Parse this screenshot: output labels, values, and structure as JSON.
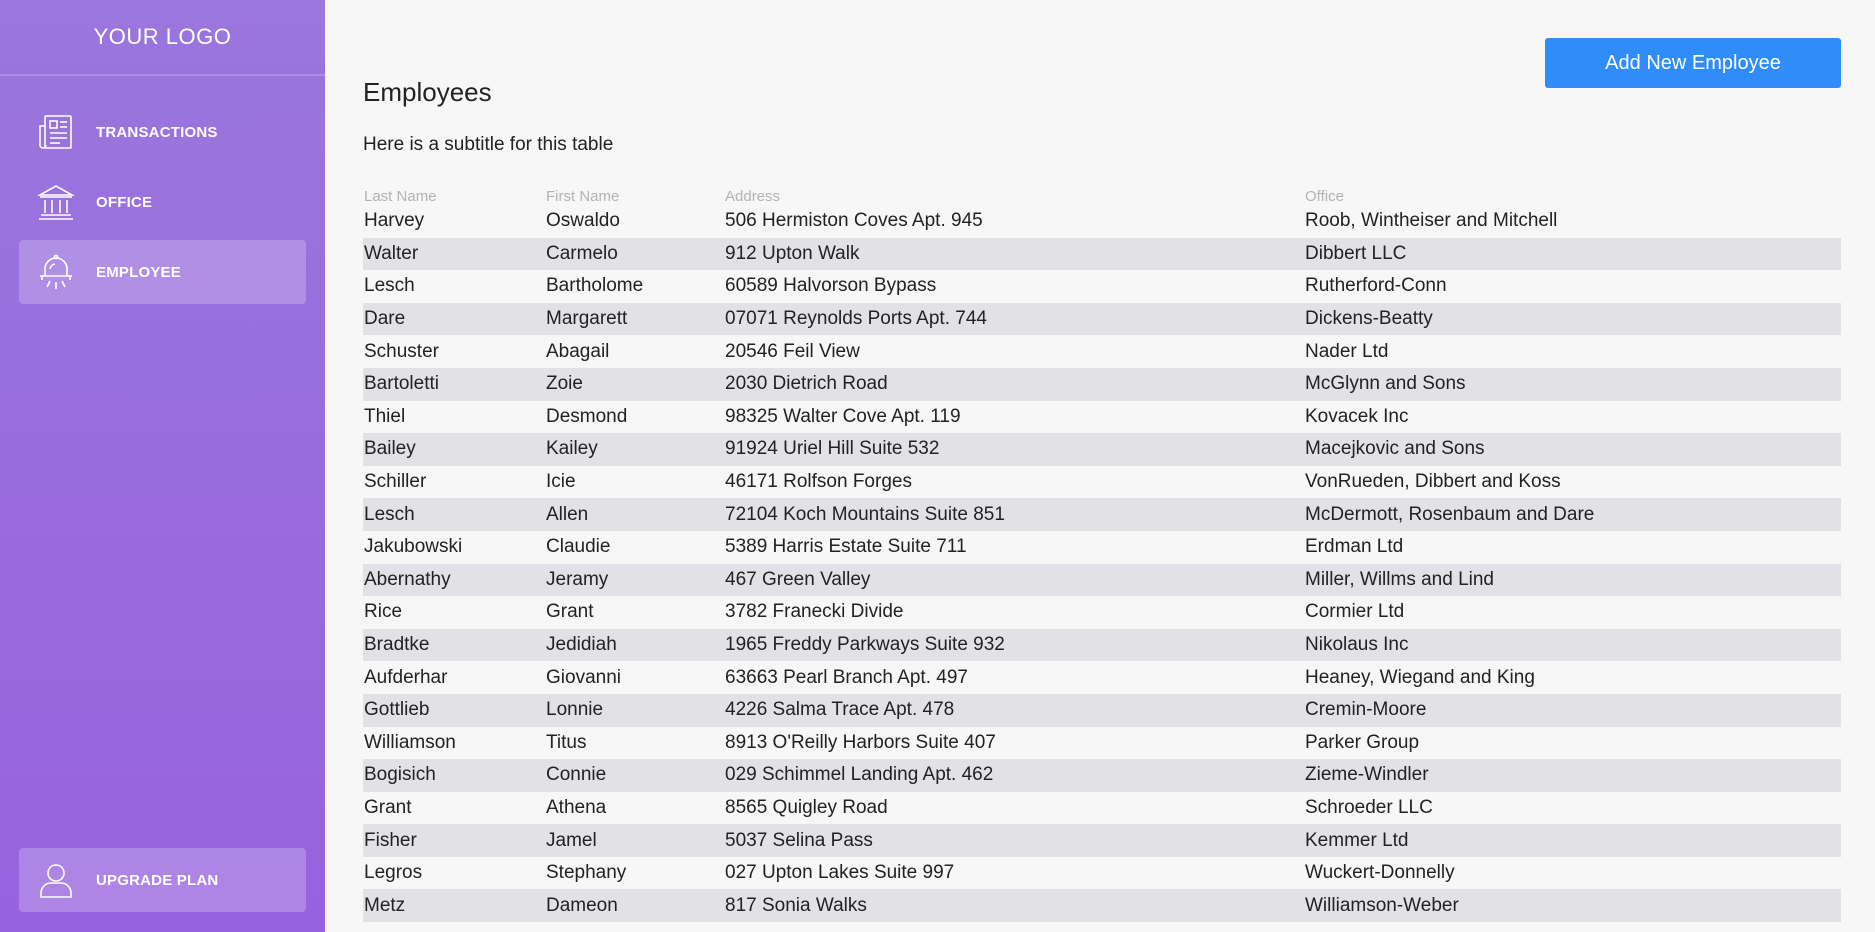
{
  "logo": "YOUR LOGO",
  "nav": {
    "transactions": "TRANSACTIONS",
    "office": "OFFICE",
    "employee": "EMPLOYEE",
    "upgrade": "UPGRADE PLAN"
  },
  "header": {
    "add_button": "Add New Employee",
    "title": "Employees",
    "subtitle": "Here is a subtitle for this table"
  },
  "table": {
    "columns": [
      "Last Name",
      "First Name",
      "Address",
      "Office"
    ],
    "rows": [
      [
        "Harvey",
        "Oswaldo",
        "506 Hermiston Coves Apt. 945",
        "Roob, Wintheiser and Mitchell"
      ],
      [
        "Walter",
        "Carmelo",
        "912 Upton Walk",
        "Dibbert LLC"
      ],
      [
        "Lesch",
        "Bartholome",
        "60589 Halvorson Bypass",
        "Rutherford-Conn"
      ],
      [
        "Dare",
        "Margarett",
        "07071 Reynolds Ports Apt. 744",
        "Dickens-Beatty"
      ],
      [
        "Schuster",
        "Abagail",
        "20546 Feil View",
        "Nader Ltd"
      ],
      [
        "Bartoletti",
        "Zoie",
        "2030 Dietrich Road",
        "McGlynn and Sons"
      ],
      [
        "Thiel",
        "Desmond",
        "98325 Walter Cove Apt. 119",
        "Kovacek Inc"
      ],
      [
        "Bailey",
        "Kailey",
        "91924 Uriel Hill Suite 532",
        "Macejkovic and Sons"
      ],
      [
        "Schiller",
        "Icie",
        "46171 Rolfson Forges",
        "VonRueden, Dibbert and Koss"
      ],
      [
        "Lesch",
        "Allen",
        "72104 Koch Mountains Suite 851",
        "McDermott, Rosenbaum and Dare"
      ],
      [
        "Jakubowski",
        "Claudie",
        "5389 Harris Estate Suite 711",
        "Erdman Ltd"
      ],
      [
        "Abernathy",
        "Jeramy",
        "467 Green Valley",
        "Miller, Willms and Lind"
      ],
      [
        "Rice",
        "Grant",
        "3782 Franecki Divide",
        "Cormier Ltd"
      ],
      [
        "Bradtke",
        "Jedidiah",
        "1965 Freddy Parkways Suite 932",
        "Nikolaus Inc"
      ],
      [
        "Aufderhar",
        "Giovanni",
        "63663 Pearl Branch Apt. 497",
        "Heaney, Wiegand and King"
      ],
      [
        "Gottlieb",
        "Lonnie",
        "4226 Salma Trace Apt. 478",
        "Cremin-Moore"
      ],
      [
        "Williamson",
        "Titus",
        "8913 O'Reilly Harbors Suite 407",
        "Parker Group"
      ],
      [
        "Bogisich",
        "Connie",
        "029 Schimmel Landing Apt. 462",
        "Zieme-Windler"
      ],
      [
        "Grant",
        "Athena",
        "8565 Quigley Road",
        "Schroeder LLC"
      ],
      [
        "Fisher",
        "Jamel",
        "5037 Selina Pass",
        "Kemmer Ltd"
      ],
      [
        "Legros",
        "Stephany",
        "027 Upton Lakes Suite 997",
        "Wuckert-Donnelly"
      ],
      [
        "Metz",
        "Dameon",
        "817 Sonia Walks",
        "Williamson-Weber"
      ]
    ]
  },
  "colors": {
    "sidebar_top": "#9a76dd",
    "sidebar_bottom": "#9862de",
    "accent_button": "#2f8cf8",
    "stripe_row": "#e2e1e5",
    "background": "#f7f7f7"
  },
  "icons": {
    "transactions": "newspaper-icon",
    "office": "bank-building-icon",
    "employee": "bell-alarm-icon",
    "upgrade": "user-icon"
  }
}
